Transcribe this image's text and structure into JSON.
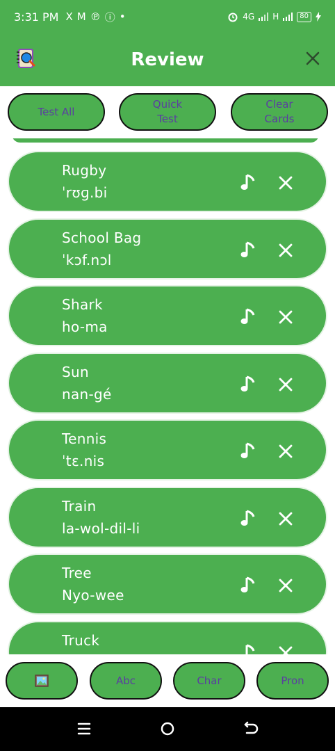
{
  "status_bar": {
    "time": "3:31 PM",
    "left_icons": [
      "X",
      "M",
      "℗",
      "ⓘ",
      "•"
    ],
    "network_label": "4G",
    "signal2_label": "H",
    "battery": "80"
  },
  "app_bar": {
    "title": "Review",
    "logo_icon": "notebook-search-icon",
    "close_icon": "close-icon"
  },
  "top_actions": {
    "test_all": "Test All",
    "quick_test": "Quick\nTest",
    "clear_cards": "Clear\nCards"
  },
  "cards": [
    {
      "word": "Rugby",
      "pron": "ˈrʊɡ.bi"
    },
    {
      "word": "School Bag",
      "pron": "ˈkɔf.nɔl"
    },
    {
      "word": "Shark",
      "pron": "ho-ma"
    },
    {
      "word": "Sun",
      "pron": "nan-gé"
    },
    {
      "word": "Tennis",
      "pron": "ˈtɛ.nis"
    },
    {
      "word": "Train",
      "pron": "la-wol-dil-li"
    },
    {
      "word": "Tree",
      "pron": "Nyo-wee"
    },
    {
      "word": "Truck",
      "pron": ""
    }
  ],
  "bottom_bar": {
    "image_button_icon": "picture-icon",
    "abc": "Abc",
    "char": "Char",
    "pron": "Pron"
  },
  "colors": {
    "primary": "#4caf50",
    "button_text": "#5a3fa0",
    "card_border": "#e5f3e5"
  }
}
